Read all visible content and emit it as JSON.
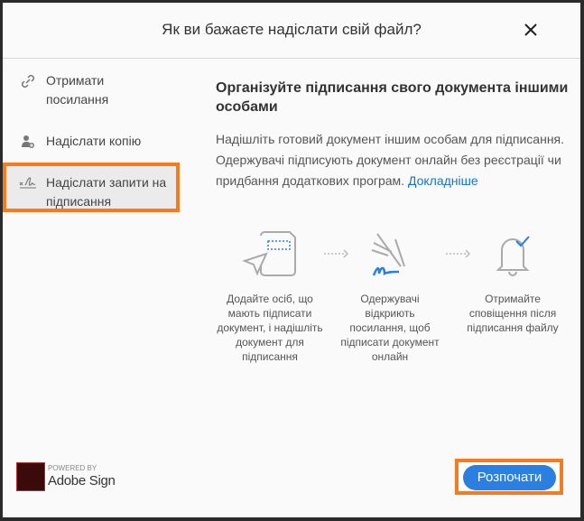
{
  "dialog": {
    "title": "Як ви бажаєте надіслати свій файл?",
    "close_icon": "close-icon"
  },
  "sidebar": {
    "items": [
      {
        "label_line1": "Отримати",
        "label_line2": "посилання",
        "icon": "link-icon"
      },
      {
        "label_line1": "Надіслати копію",
        "icon": "add-person-icon"
      },
      {
        "label_line1": "Надіслати запити на",
        "label_line2": "підписання",
        "icon": "signature-icon",
        "selected": true
      }
    ]
  },
  "main": {
    "heading": "Організуйте підписання свого документа іншими особами",
    "description": "Надішліть готовий документ іншим особам для підписання. Одержувачі підписують документ онлайн без реєстрації чи придбання додаткових програм.",
    "learn_more": "Докладніше",
    "steps": [
      {
        "text": "Додайте осіб, що мають підписати документ, і надішліть документ для підписання"
      },
      {
        "text": "Одержувачі відкриють посилання, щоб підписати документ онлайн"
      },
      {
        "text": "Отримайте сповіщення після підписання файлу"
      }
    ]
  },
  "footer": {
    "powered_by": "POWERED BY",
    "brand": "Adobe Sign",
    "start_button": "Розпочати"
  },
  "colors": {
    "accent": "#2a7fe0",
    "highlight": "#f47b20",
    "link": "#1473c9"
  }
}
